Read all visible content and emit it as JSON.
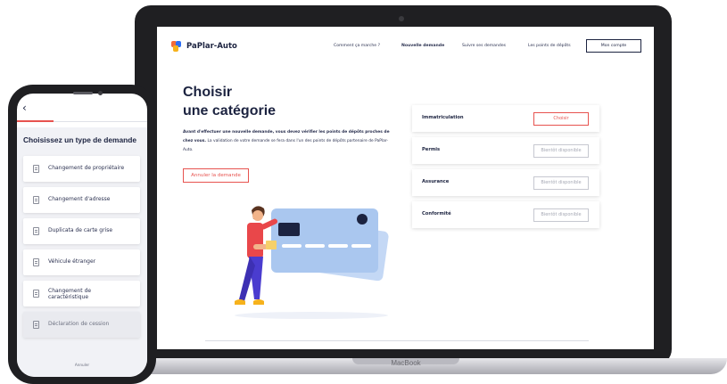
{
  "laptop": {
    "brand": "MacBook",
    "site": {
      "logo_text": "PaPlar-Auto",
      "nav": [
        "Comment ça marche ?",
        "Nouvelle demande",
        "Suivre ses demandes",
        "Les points de dépôts"
      ],
      "account_button": "Mon compte",
      "title_line1": "Choisir",
      "title_line2": "une catégorie",
      "description_bold": "Avant d'effectuer une nouvelle demande, vous devez vérifier les points de dépôts proches de chez vous.",
      "description_rest": "La validation de votre demande se fera dans l'un des points de dépôts partenaire de PaPlar-Auto.",
      "cancel_button": "Annuler la demande",
      "categories": [
        {
          "name": "Immatriculation",
          "action": "Choisir"
        },
        {
          "name": "Permis",
          "action": "Bientôt disponible"
        },
        {
          "name": "Assurance",
          "action": "Bientôt disponible"
        },
        {
          "name": "Conformité",
          "action": "Bientôt disponible"
        }
      ]
    }
  },
  "phone": {
    "back_icon": "chevron-left-icon",
    "progress": 0.28,
    "title": "Choisissez un type de demande",
    "items": [
      "Changement de propriétaire",
      "Changement d'adresse",
      "Duplicata de carte grise",
      "Véhicule étranger",
      "Changement de caractéristique",
      "Déclaration de cession"
    ],
    "cancel": "Annuler"
  },
  "colors": {
    "accent": "#e7534f",
    "navy": "#1c2340",
    "card_blue": "#aac7ef",
    "person_red": "#e9474a",
    "person_pants": "#4a3ccf"
  }
}
